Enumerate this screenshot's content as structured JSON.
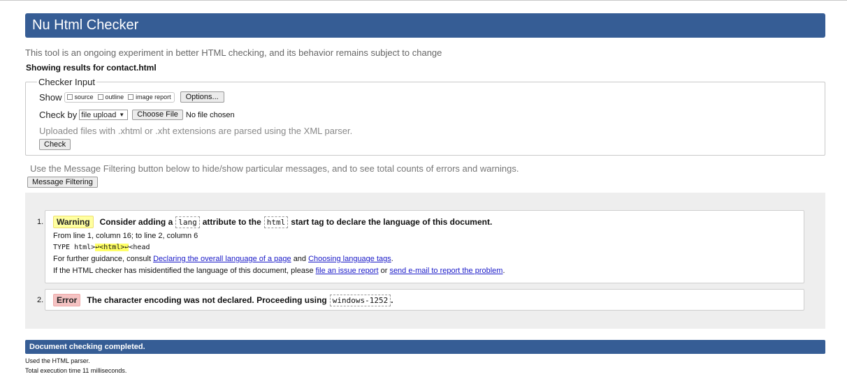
{
  "header": {
    "title": "Nu Html Checker"
  },
  "tagline": "This tool is an ongoing experiment in better HTML checking, and its behavior remains subject to change",
  "showing": "Showing results for contact.html",
  "checker_input": {
    "legend": "Checker Input",
    "show_label": "Show",
    "checkboxes": [
      "source",
      "outline",
      "image report"
    ],
    "options_button": "Options...",
    "check_by_label": "Check by",
    "check_by_value": "file upload",
    "choose_file_button": "Choose File",
    "no_file_text": "No file chosen",
    "xml_note": "Uploaded files with .xhtml or .xht extensions are parsed using the XML parser.",
    "check_button": "Check"
  },
  "filter": {
    "note": "Use the Message Filtering button below to hide/show particular messages, and to see total counts of errors and warnings.",
    "button": "Message Filtering"
  },
  "messages": [
    {
      "number": "1.",
      "type": "Warning",
      "text_a": "Consider adding a",
      "code_a": "lang",
      "text_b": "attribute to the",
      "code_b": "html",
      "text_c": "start tag to declare the language of this document.",
      "location": "From line 1, column 16; to line 2, column 6",
      "extract_pre": "TYPE html>",
      "extract_hl": "↩<html>↩",
      "extract_post": "<head",
      "guidance_pre": "For further guidance, consult",
      "guidance_link1": "Declaring the overall language of a page",
      "guidance_and": "and",
      "guidance_link2": "Choosing language tags",
      "guidance_end": ".",
      "misid_pre": "If the HTML checker has misidentified the language of this document, please",
      "misid_link1": "file an issue report",
      "misid_or": "or",
      "misid_link2": "send e-mail to report the problem",
      "misid_end": "."
    },
    {
      "number": "2.",
      "type": "Error",
      "text_a": "The character encoding was not declared. Proceeding using",
      "code_a": "windows-1252",
      "text_end": "."
    }
  ],
  "status": "Document checking completed.",
  "footer": [
    "Used the HTML parser.",
    "Total execution time 11 milliseconds."
  ],
  "colors": {
    "header_bg": "#365d95",
    "warning_bg": "#ffffa0",
    "error_bg": "#f5c2c2",
    "link": "#1a1ac8"
  }
}
